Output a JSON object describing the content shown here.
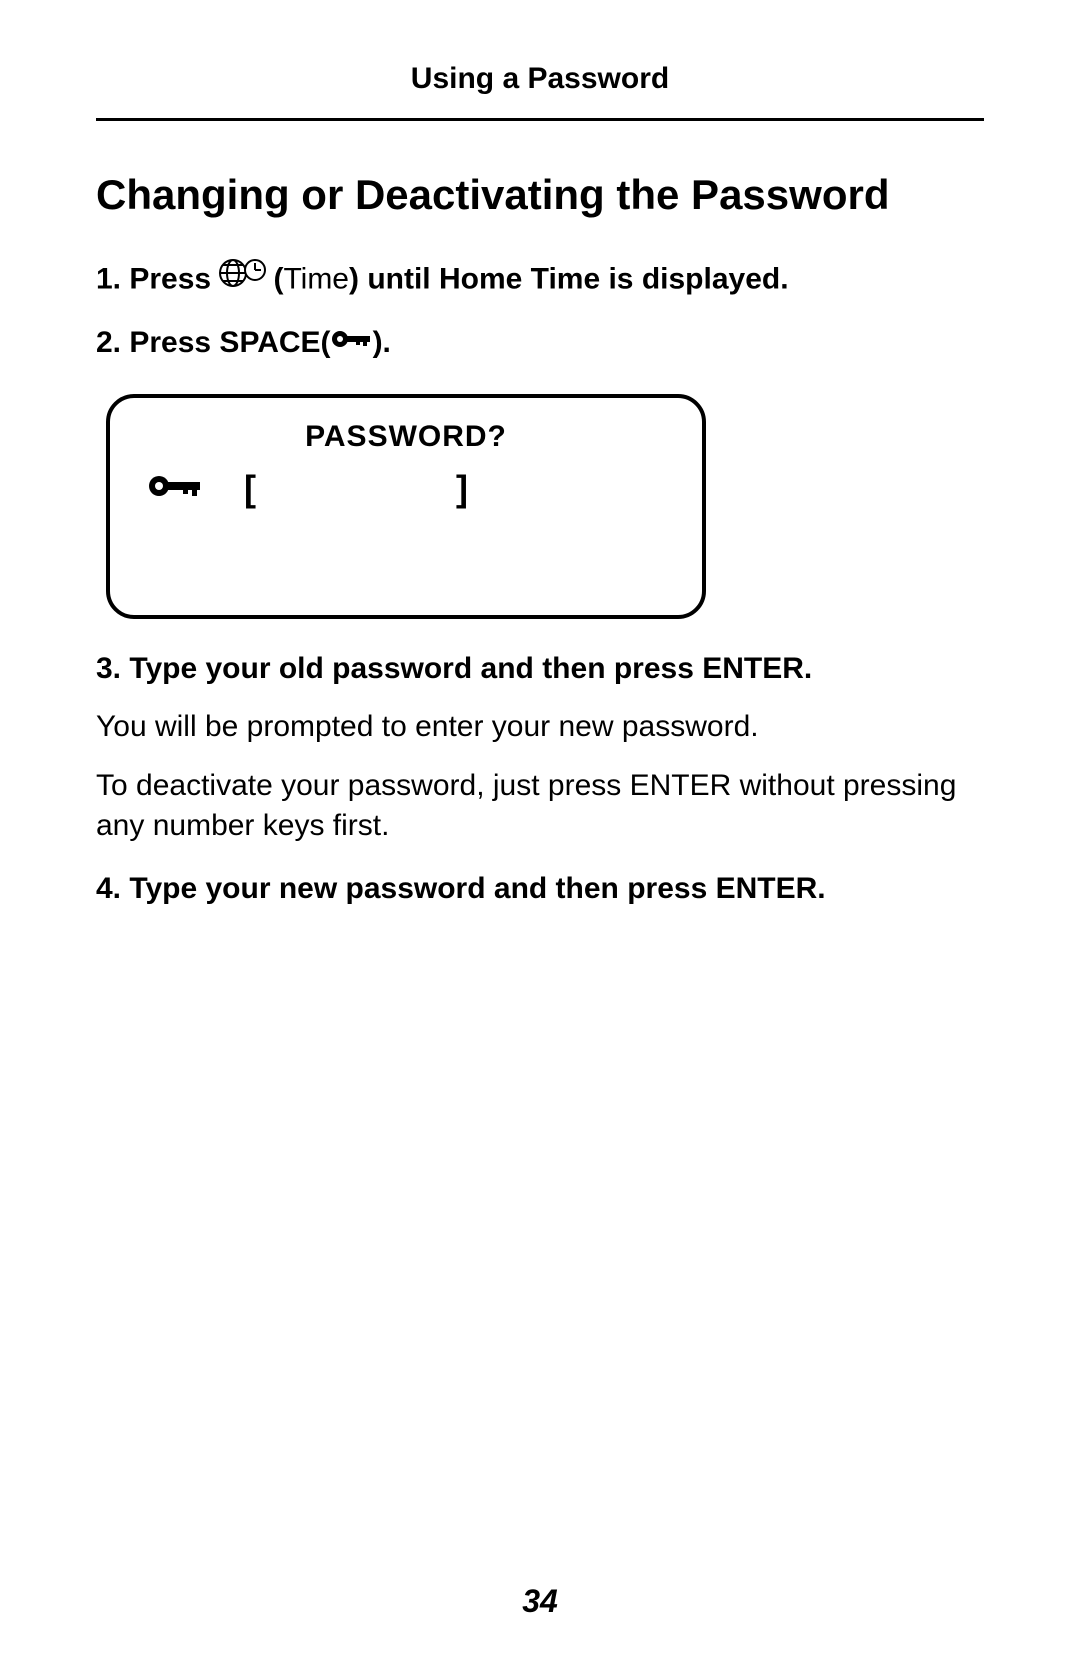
{
  "header": {
    "running_title": "Using a Password"
  },
  "section": {
    "title": "Changing or Deactivating the Password"
  },
  "steps": {
    "s1": {
      "prefix": "1. Press ",
      "time_label": "Time",
      "suffix": ") until Home Time is displayed."
    },
    "s2": {
      "prefix": "2. Press SPACE(",
      "suffix": ")."
    },
    "screen": {
      "title": "PASSWORD?",
      "left_bracket": "[",
      "right_bracket": "]"
    },
    "s3": {
      "main": "3. Type your old password and then press ENTER.",
      "para1": "You will be prompted to enter your new password.",
      "para2": "To deactivate your password, just press ENTER without pressing any number keys first."
    },
    "s4": {
      "main": "4. Type your new password and then press ENTER."
    }
  },
  "page_number": "34"
}
